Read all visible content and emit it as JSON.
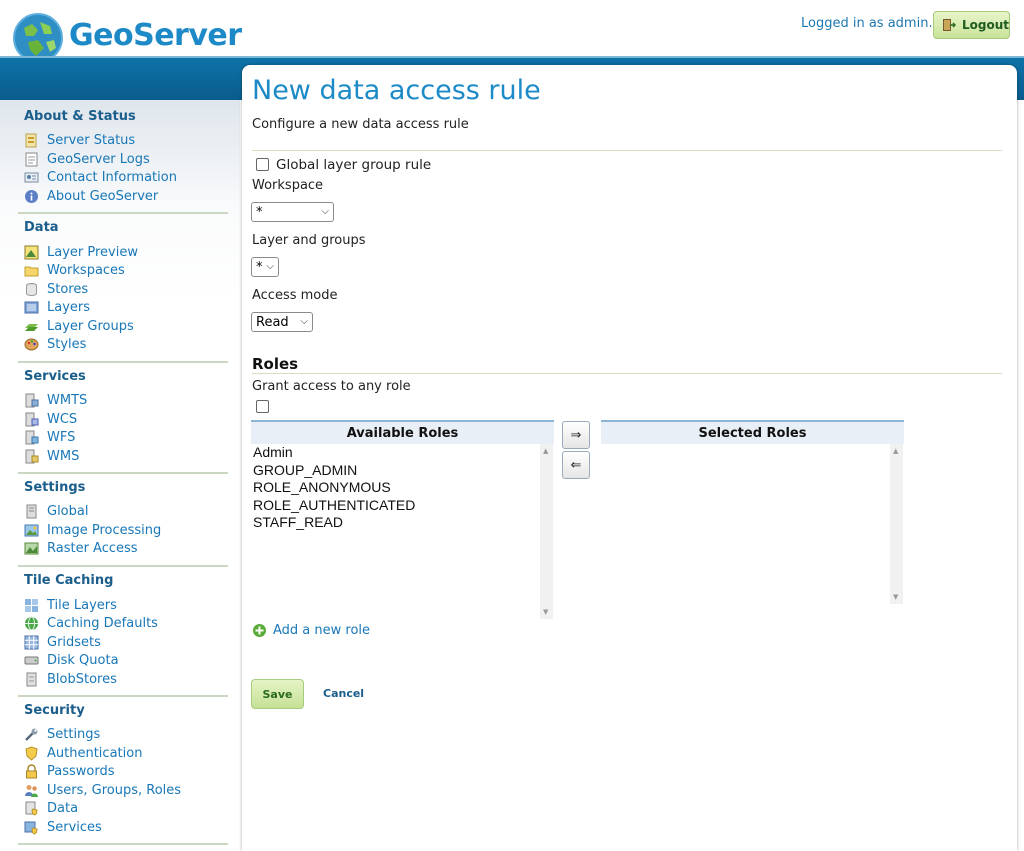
{
  "header": {
    "brand": "GeoServer",
    "logged_in_text": "Logged in as admin.",
    "logout_label": "Logout"
  },
  "sidebar": {
    "sections": [
      {
        "title": "About & Status",
        "items": [
          "Server Status",
          "GeoServer Logs",
          "Contact Information",
          "About GeoServer"
        ]
      },
      {
        "title": "Data",
        "items": [
          "Layer Preview",
          "Workspaces",
          "Stores",
          "Layers",
          "Layer Groups",
          "Styles"
        ]
      },
      {
        "title": "Services",
        "items": [
          "WMTS",
          "WCS",
          "WFS",
          "WMS"
        ]
      },
      {
        "title": "Settings",
        "items": [
          "Global",
          "Image Processing",
          "Raster Access"
        ]
      },
      {
        "title": "Tile Caching",
        "items": [
          "Tile Layers",
          "Caching Defaults",
          "Gridsets",
          "Disk Quota",
          "BlobStores"
        ]
      },
      {
        "title": "Security",
        "items": [
          "Settings",
          "Authentication",
          "Passwords",
          "Users, Groups, Roles",
          "Data",
          "Services"
        ]
      }
    ]
  },
  "main": {
    "title": "New data access rule",
    "description": "Configure a new data access rule",
    "global_layer_group_label": "Global layer group rule",
    "workspace_label": "Workspace",
    "workspace_value": "*",
    "layer_label": "Layer and groups",
    "layer_value": "*",
    "access_mode_label": "Access mode",
    "access_mode_value": "Read",
    "roles_title": "Roles",
    "grant_any_label": "Grant access to any role",
    "available_roles_header": "Available Roles",
    "selected_roles_header": "Selected Roles",
    "available_roles": [
      "Admin",
      "GROUP_ADMIN",
      "ROLE_ANONYMOUS",
      "ROLE_AUTHENTICATED",
      "STAFF_READ"
    ],
    "selected_roles": [],
    "add_right": "⇒",
    "add_left": "⇐",
    "add_role_label": "Add a new role",
    "save_label": "Save",
    "cancel_label": "Cancel"
  }
}
